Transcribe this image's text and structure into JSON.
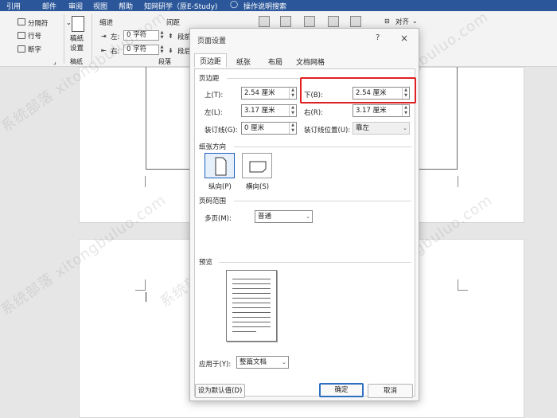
{
  "menubar": {
    "items": [
      "引用",
      "邮件",
      "审阅",
      "视图",
      "帮助",
      "知网研学（原E-Study)"
    ],
    "tell_me": "操作说明搜索"
  },
  "ribbon": {
    "col_breaks": "分隔符",
    "line_numbers": "行号",
    "hyphenation": "断字",
    "manuscript_line1": "稿纸",
    "manuscript_line2": "设置",
    "manuscript_group": "稿纸",
    "indent_title": "缩进",
    "spacing_title": "间距",
    "indent_left_label": "左:",
    "indent_left_value": "0 字符",
    "indent_right_label": "右:",
    "indent_right_value": "0 字符",
    "spacing_before_label": "段前",
    "spacing_after_label": "段后",
    "paragraph_group": "段落",
    "align": "对齐"
  },
  "dialog": {
    "title": "页面设置",
    "help": "?",
    "close": "×",
    "tabs": [
      "页边距",
      "纸张",
      "布局",
      "文档网格"
    ],
    "margins_section": "页边距",
    "top_label": "上(T):",
    "top_value": "2.54 厘米",
    "bottom_label": "下(B):",
    "bottom_value": "2.54 厘米",
    "left_label": "左(L):",
    "left_value": "3.17 厘米",
    "right_label": "右(R):",
    "right_value": "3.17 厘米",
    "gutter_label": "装订线(G):",
    "gutter_value": "0 厘米",
    "gutter_pos_label": "装订线位置(U):",
    "gutter_pos_value": "靠左",
    "orientation_section": "纸张方向",
    "portrait": "纵向(P)",
    "landscape": "横向(S)",
    "pages_section": "页码范围",
    "multiple_pages_label": "多页(M):",
    "multiple_pages_value": "普通",
    "preview_section": "预览",
    "apply_to_label": "应用于(Y):",
    "apply_to_value": "整篇文档",
    "set_default": "设为默认值(D)",
    "ok": "确定",
    "cancel": "取消",
    "highlight_color": "#e02020"
  },
  "watermark": "系统部落 xitongbuluo.com"
}
